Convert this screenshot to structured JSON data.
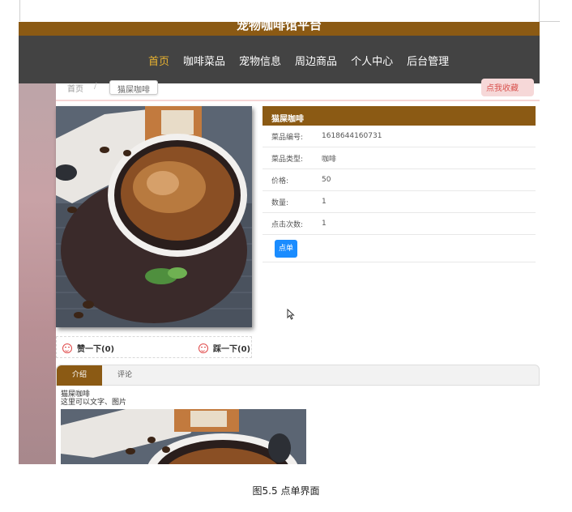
{
  "site": {
    "title": "宠物咖啡馆平台"
  },
  "nav": {
    "items": [
      "首页",
      "咖啡菜品",
      "宠物信息",
      "周边商品",
      "个人中心",
      "后台管理"
    ],
    "active_index": 0
  },
  "breadcrumb": {
    "home": "首页",
    "separator": "/",
    "current": "猫屎咖啡",
    "right_link": "点我收藏"
  },
  "votes": {
    "like_label": "赞一下(0)",
    "dislike_label": "踩一下(0)"
  },
  "detail": {
    "title": "猫屎咖啡",
    "rows": [
      {
        "label": "菜品编号:",
        "value": "1618644160731"
      },
      {
        "label": "菜品类型:",
        "value": "咖啡"
      },
      {
        "label": "价格:",
        "value": "50"
      },
      {
        "label": "数量:",
        "value": "1"
      },
      {
        "label": "点击次数:",
        "value": "1"
      }
    ],
    "order_button": "点单"
  },
  "tabs": {
    "items": [
      "介绍",
      "评论"
    ],
    "active_index": 0
  },
  "intro": {
    "line1": "猫屎咖啡",
    "line2": "这里可以文字、图片"
  },
  "caption": "图5.5  点单界面",
  "colors": {
    "brand": "#8b5a14",
    "nav_bg": "#434343",
    "nav_active": "#e8b230",
    "button_blue": "#1a8cff"
  }
}
